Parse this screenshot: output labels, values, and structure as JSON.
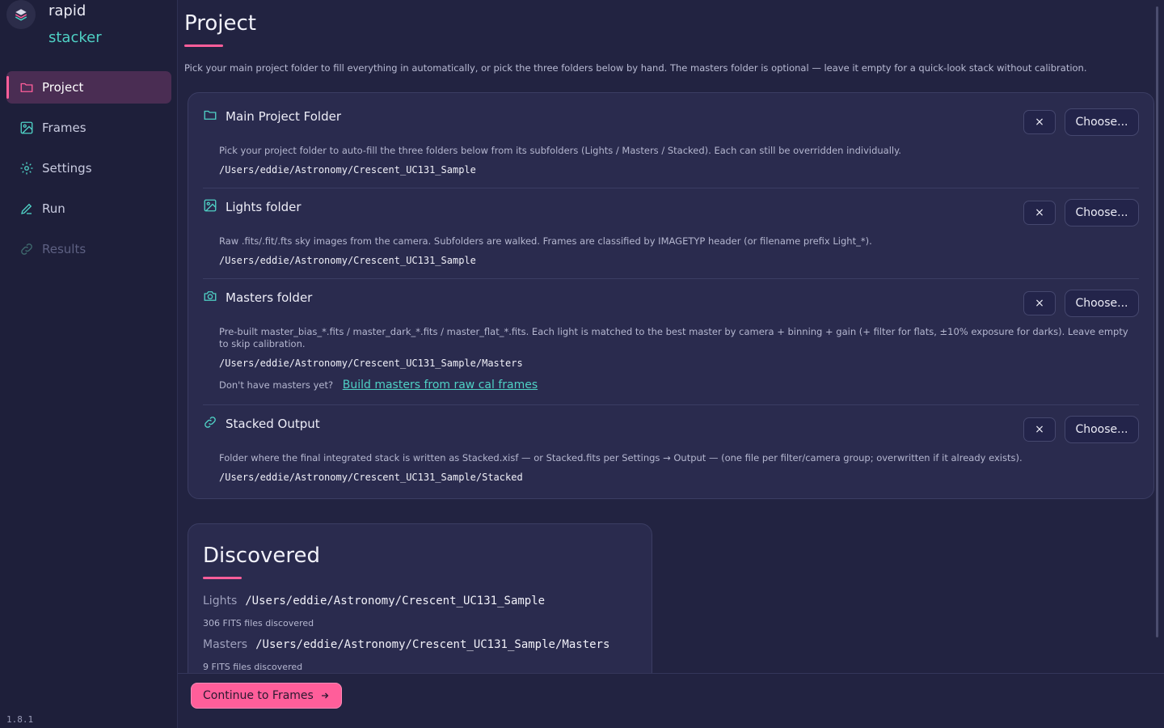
{
  "brand": {
    "line1": "rapid",
    "line2": "stacker"
  },
  "nav": [
    {
      "label": "Project",
      "icon": "folder-icon",
      "state": "active"
    },
    {
      "label": "Frames",
      "icon": "image-icon",
      "state": "normal"
    },
    {
      "label": "Settings",
      "icon": "gear-icon",
      "state": "normal"
    },
    {
      "label": "Run",
      "icon": "pen-icon",
      "state": "normal"
    },
    {
      "label": "Results",
      "icon": "link-icon",
      "state": "disabled"
    }
  ],
  "version": "1.8.1",
  "page": {
    "title": "Project",
    "intro": "Pick your main project folder to fill everything in automatically, or pick the three folders below by hand. The masters folder is optional — leave it empty for a quick-look stack without calibration."
  },
  "sections": [
    {
      "title": "Main Project Folder",
      "icon": "folder-icon",
      "description": "Pick your project folder to auto-fill the three folders below from its subfolders (Lights / Masters / Stacked). Each can still be overridden individually.",
      "path": "/Users/eddie/Astronomy/Crescent_UC131_Sample",
      "clear_label": "×",
      "choose_label": "Choose..."
    },
    {
      "title": "Lights folder",
      "icon": "image-icon",
      "description": "Raw .fits/.fit/.fts sky images from the camera. Subfolders are walked. Frames are classified by IMAGETYP header (or filename prefix Light_*).",
      "path": "/Users/eddie/Astronomy/Crescent_UC131_Sample",
      "clear_label": "×",
      "choose_label": "Choose..."
    },
    {
      "title": "Masters folder",
      "icon": "camera-icon",
      "description": "Pre-built master_bias_*.fits / master_dark_*.fits / master_flat_*.fits. Each light is matched to the best master by camera + binning + gain (+ filter for flats, ±10% exposure for darks). Leave empty to skip calibration.",
      "path": "/Users/eddie/Astronomy/Crescent_UC131_Sample/Masters",
      "clear_label": "×",
      "choose_label": "Choose...",
      "hint": "Don't have masters yet?",
      "link": "Build masters from raw cal frames"
    },
    {
      "title": "Stacked Output",
      "icon": "link-icon",
      "description": "Folder where the final integrated stack is written as Stacked.xisf — or Stacked.fits per Settings → Output — (one file per filter/camera group; overwritten if it already exists).",
      "path": "/Users/eddie/Astronomy/Crescent_UC131_Sample/Stacked",
      "clear_label": "×",
      "choose_label": "Choose..."
    }
  ],
  "discovered": {
    "title": "Discovered",
    "lights_label": "Lights",
    "lights_path": "/Users/eddie/Astronomy/Crescent_UC131_Sample",
    "lights_count": "306 FITS files discovered",
    "masters_label": "Masters",
    "masters_path": "/Users/eddie/Astronomy/Crescent_UC131_Sample/Masters",
    "masters_count": "9 FITS files discovered"
  },
  "footer": {
    "continue_label": "Continue to Frames"
  },
  "colors": {
    "accent": "#ff5e9a",
    "teal": "#4fd1c5",
    "bg": "#222341",
    "card": "#2a2b4e"
  }
}
